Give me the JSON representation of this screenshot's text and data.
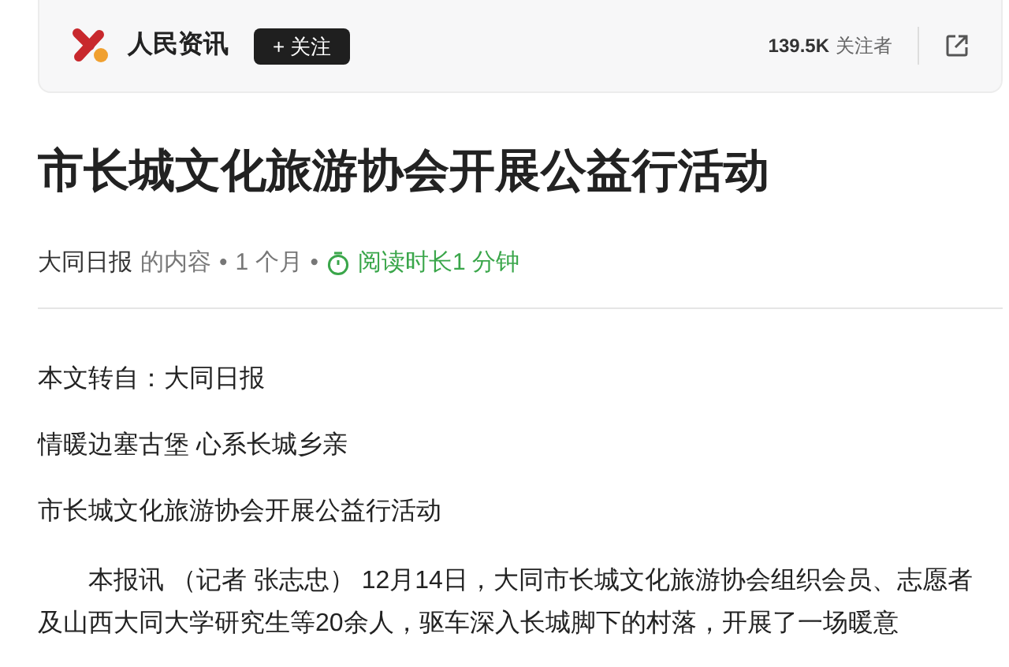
{
  "header": {
    "source_name": "人民资讯",
    "follow_button": "+ 关注",
    "followers_count": "139.5K",
    "followers_label": "关注者"
  },
  "article": {
    "title": "市长城文化旅游协会开展公益行活动",
    "meta": {
      "author": "大同日报",
      "suffix": "的内容",
      "separator_1": "•",
      "age": "1 个月",
      "separator_2": "•",
      "reading_time": "阅读时长1 分钟"
    },
    "paragraphs": [
      {
        "kind": "plain",
        "text": "本文转自：大同日报"
      },
      {
        "kind": "plain",
        "text": "情暖边塞古堡 心系长城乡亲"
      },
      {
        "kind": "plain",
        "text": "市长城文化旅游协会开展公益行活动"
      },
      {
        "kind": "indented",
        "text": "本报讯 （记者 张志忠） 12月14日，大同市长城文化旅游协会组织会员、志愿者及山西大同大学研究生等20余人，驱车深入长城脚下的村落，开展了一场暖意"
      }
    ]
  }
}
